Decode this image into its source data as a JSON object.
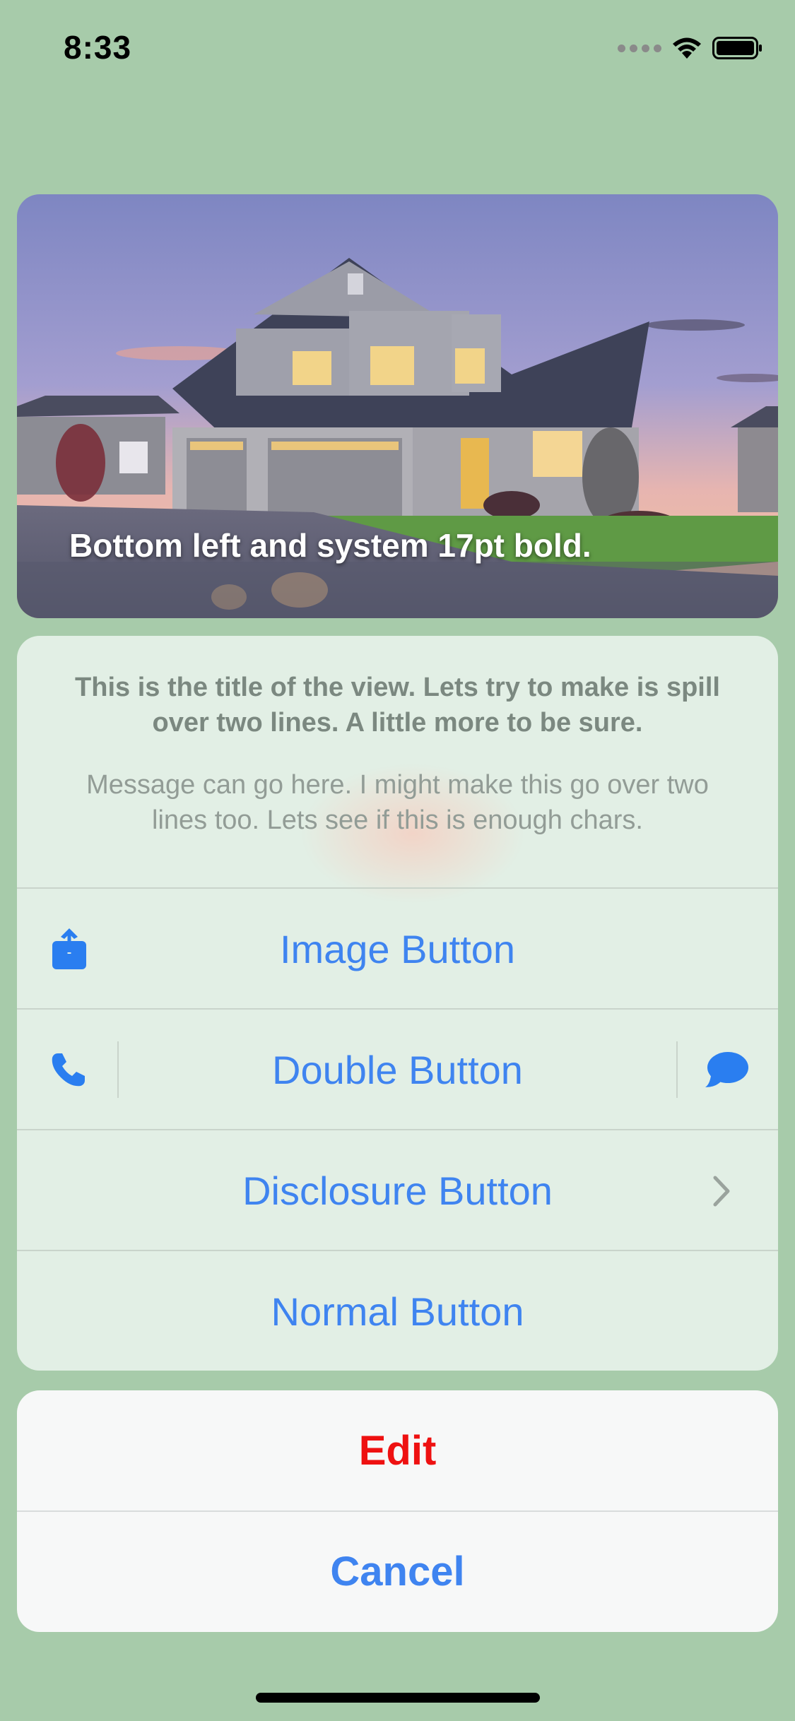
{
  "status_bar": {
    "time": "8:33",
    "icons": [
      "signal-dots-icon",
      "wifi-icon",
      "battery-icon"
    ]
  },
  "hero": {
    "caption": "Bottom left and system 17pt bold."
  },
  "sheet": {
    "title": "This is the title of the view. Lets try to make is spill over two lines. A little more to be sure.",
    "message": "Message can go here. I might make this go over two lines too. Lets see if this is enough chars.",
    "buttons": {
      "image_button": {
        "label": "Image Button",
        "icon": "share-icon"
      },
      "double_button": {
        "label": "Double Button",
        "left_icon": "phone-icon",
        "right_icon": "message-bubble-icon"
      },
      "disclosure_button": {
        "label": "Disclosure Button",
        "icon": "chevron-right-icon"
      },
      "normal_button": {
        "label": "Normal Button"
      }
    }
  },
  "cancel_sheet": {
    "edit_label": "Edit",
    "cancel_label": "Cancel"
  },
  "colors": {
    "background": "#a7cbaa",
    "accent_blue": "#3f84f0",
    "destructive_red": "#ee1111"
  }
}
